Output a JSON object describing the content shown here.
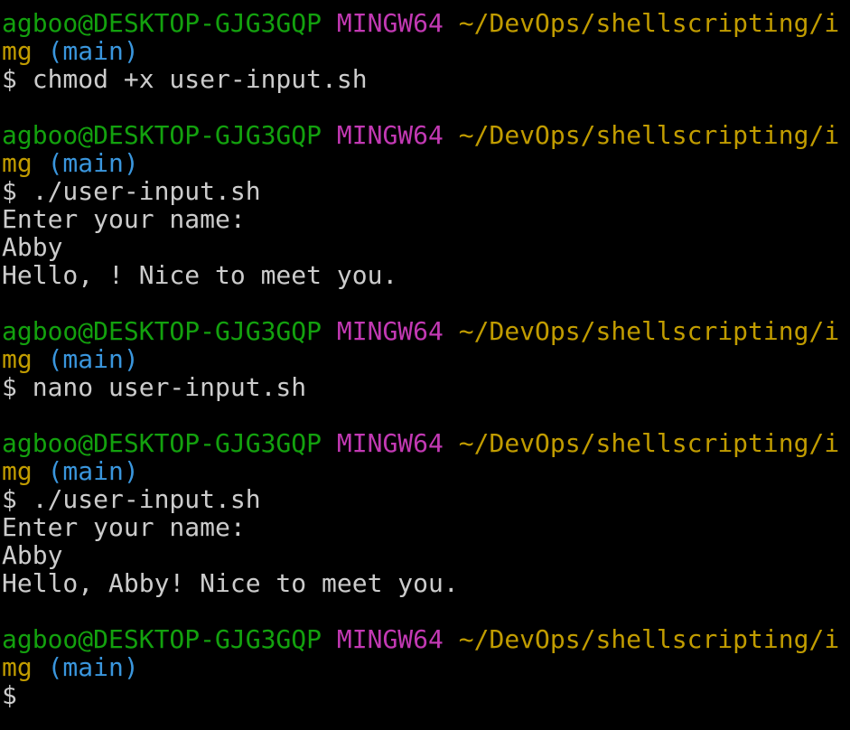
{
  "terminal": {
    "colors": {
      "background": "#000000",
      "text": "#cccccc",
      "user": "#13a10e",
      "system": "#c239b3",
      "path": "#c19c00",
      "branch": "#3a96dd"
    },
    "blocks": [
      {
        "prompt": {
          "user_host": "agboo@DESKTOP-GJG3GQP",
          "system": "MINGW64",
          "path_line1": "~/DevOps/shellscripting/i",
          "path_line2": "mg",
          "branch": "(main)"
        },
        "command": "$ chmod +x user-input.sh",
        "output": []
      },
      {
        "prompt": {
          "user_host": "agboo@DESKTOP-GJG3GQP",
          "system": "MINGW64",
          "path_line1": "~/DevOps/shellscripting/i",
          "path_line2": "mg",
          "branch": "(main)"
        },
        "command": "$ ./user-input.sh",
        "output": [
          "Enter your name:",
          "Abby",
          "Hello, ! Nice to meet you."
        ]
      },
      {
        "prompt": {
          "user_host": "agboo@DESKTOP-GJG3GQP",
          "system": "MINGW64",
          "path_line1": "~/DevOps/shellscripting/i",
          "path_line2": "mg",
          "branch": "(main)"
        },
        "command": "$ nano user-input.sh",
        "output": []
      },
      {
        "prompt": {
          "user_host": "agboo@DESKTOP-GJG3GQP",
          "system": "MINGW64",
          "path_line1": "~/DevOps/shellscripting/i",
          "path_line2": "mg",
          "branch": "(main)"
        },
        "command": "$ ./user-input.sh",
        "output": [
          "Enter your name:",
          "Abby",
          "Hello, Abby! Nice to meet you."
        ]
      },
      {
        "prompt": {
          "user_host": "agboo@DESKTOP-GJG3GQP",
          "system": "MINGW64",
          "path_line1": "~/DevOps/shellscripting/i",
          "path_line2": "mg",
          "branch": "(main)"
        },
        "command": "$",
        "output": []
      }
    ]
  }
}
